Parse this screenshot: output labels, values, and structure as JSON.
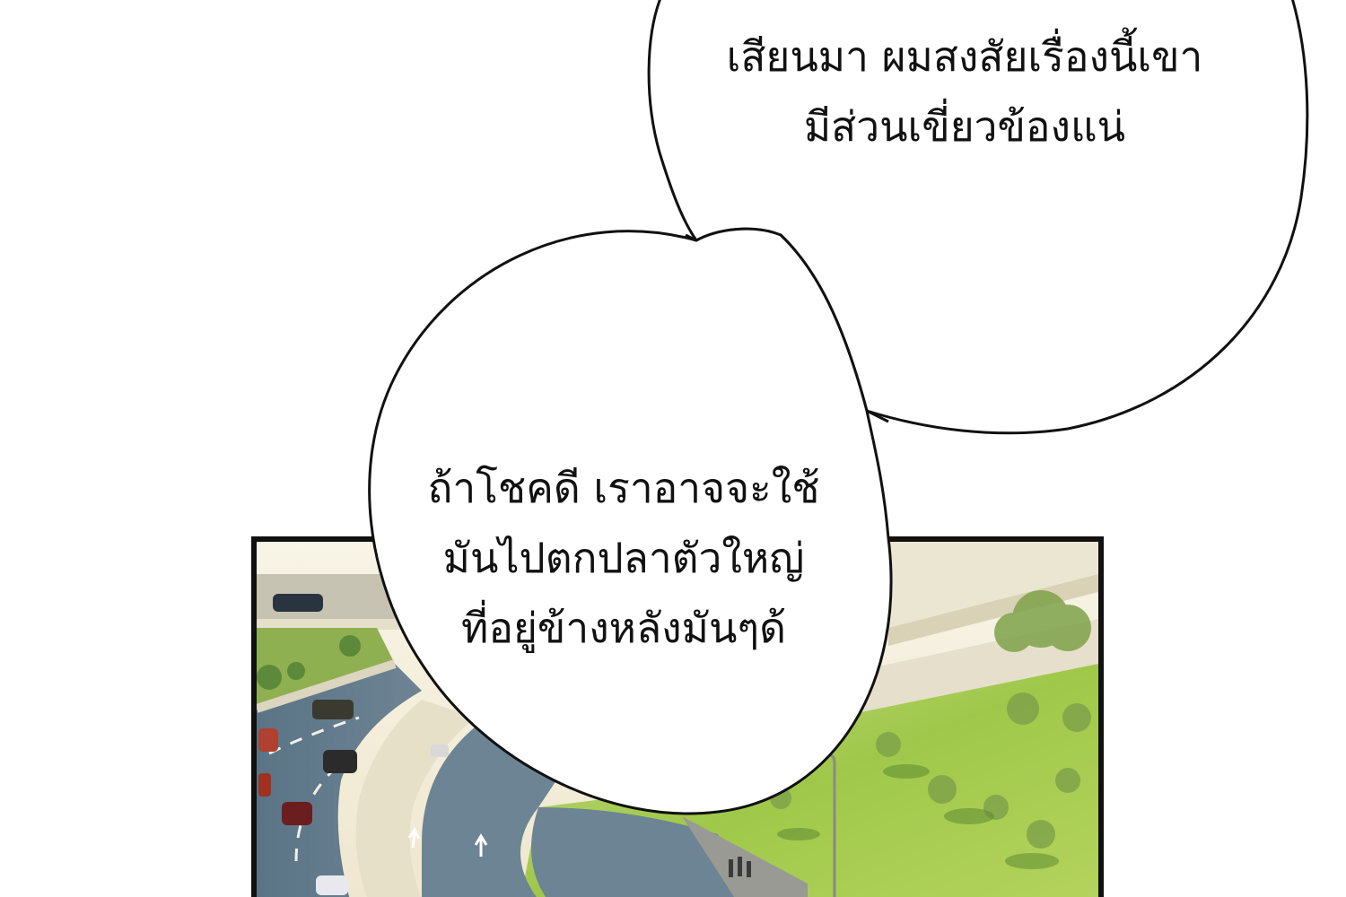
{
  "bubbles": [
    {
      "lines": [
        "เสียนมา ผมสงสัยเรื่องนี้เขา",
        "มีส่วนเขี่ยวข้องแน่"
      ]
    },
    {
      "lines": [
        "ถ้าโชคดี เราอาจจะใช้",
        "มันไปตกปลาตัวใหญ่",
        "ที่อยู่ข้างหลังมันๆด้"
      ]
    }
  ],
  "colors": {
    "background": "#ffffff",
    "ink": "#111111",
    "panel_border": "#111111",
    "sky": "#f6f2e4",
    "road": "#5c7488",
    "grass": "#9fc84a",
    "wall": "#e9e2cf"
  },
  "panel": {
    "description_icon": "highway-interchange-photo"
  }
}
